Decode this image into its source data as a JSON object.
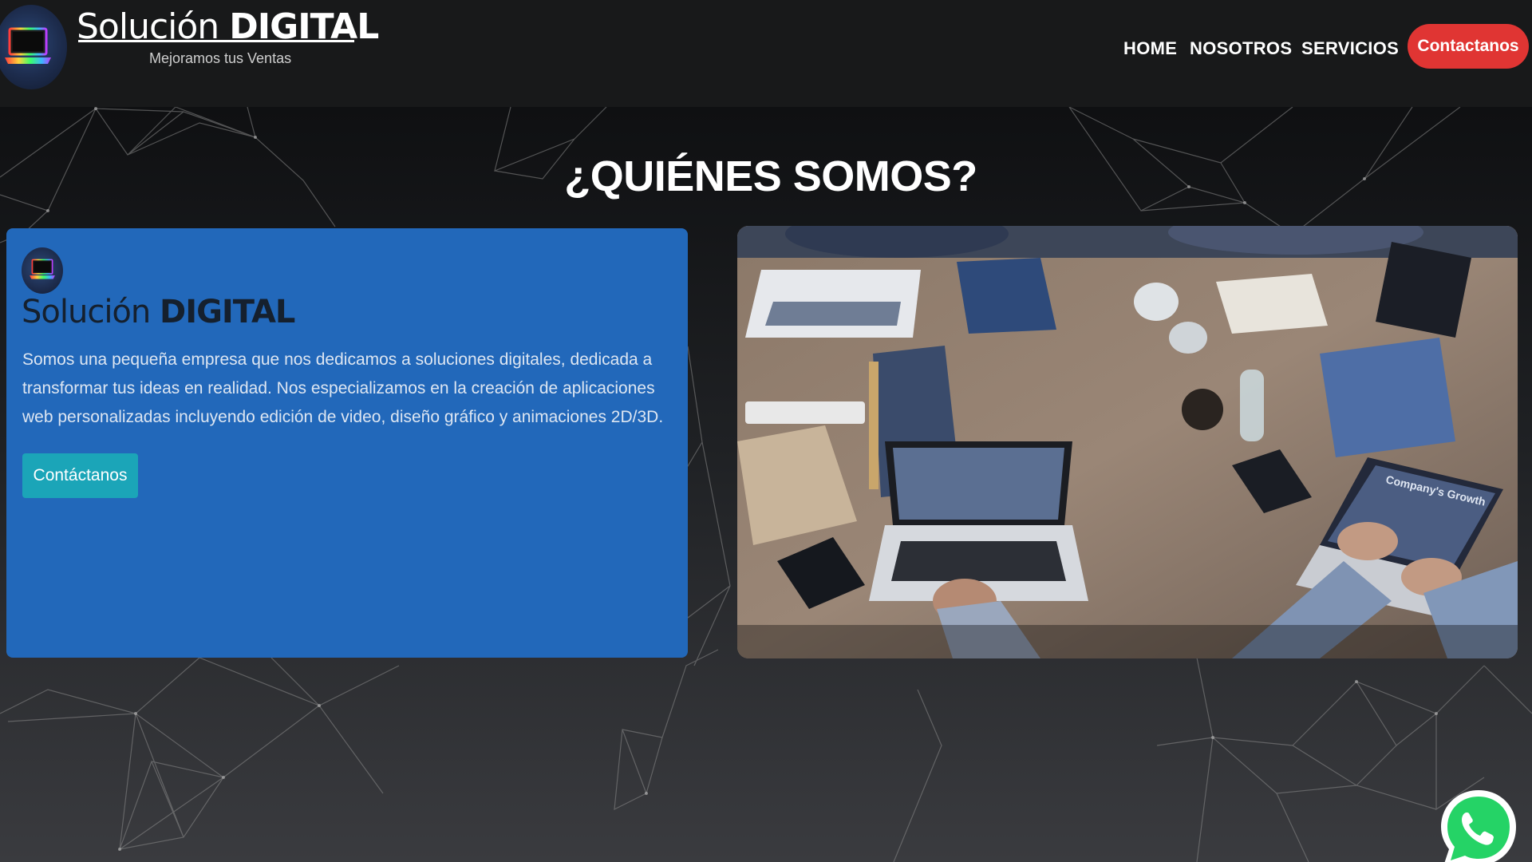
{
  "header": {
    "brand_light": "Solución",
    "brand_bold": "DIGITAL",
    "tagline": "Mejoramos tus Ventas",
    "nav": {
      "home": "HOME",
      "nosotros": "NOSOTROS",
      "servicios": "SERVICIOS",
      "contact": "Contactanos"
    }
  },
  "about": {
    "title": "¿QUIÉNES SOMOS?",
    "card": {
      "brand_light": "Solución",
      "brand_bold": "DIGITAL",
      "text": "Somos una pequeña empresa que nos dedicamos a soluciones digitales, dedicada a transformar tus ideas en realidad. Nos especializamos en la creación de aplicaciones web personalizadas incluyendo edición de video, diseño gráfico y animaciones 2D/3D.",
      "button": "Contáctanos"
    },
    "photo": {
      "laptop_text": "Company's Growth"
    }
  },
  "icons": {
    "logo": "laptop-icon",
    "floating": "whatsapp-icon"
  },
  "colors": {
    "header_bg": "#18191a",
    "accent_red": "#e03533",
    "card_blue": "#2268ba",
    "button_teal": "#1ba5b8",
    "whatsapp_green": "#25d366"
  }
}
